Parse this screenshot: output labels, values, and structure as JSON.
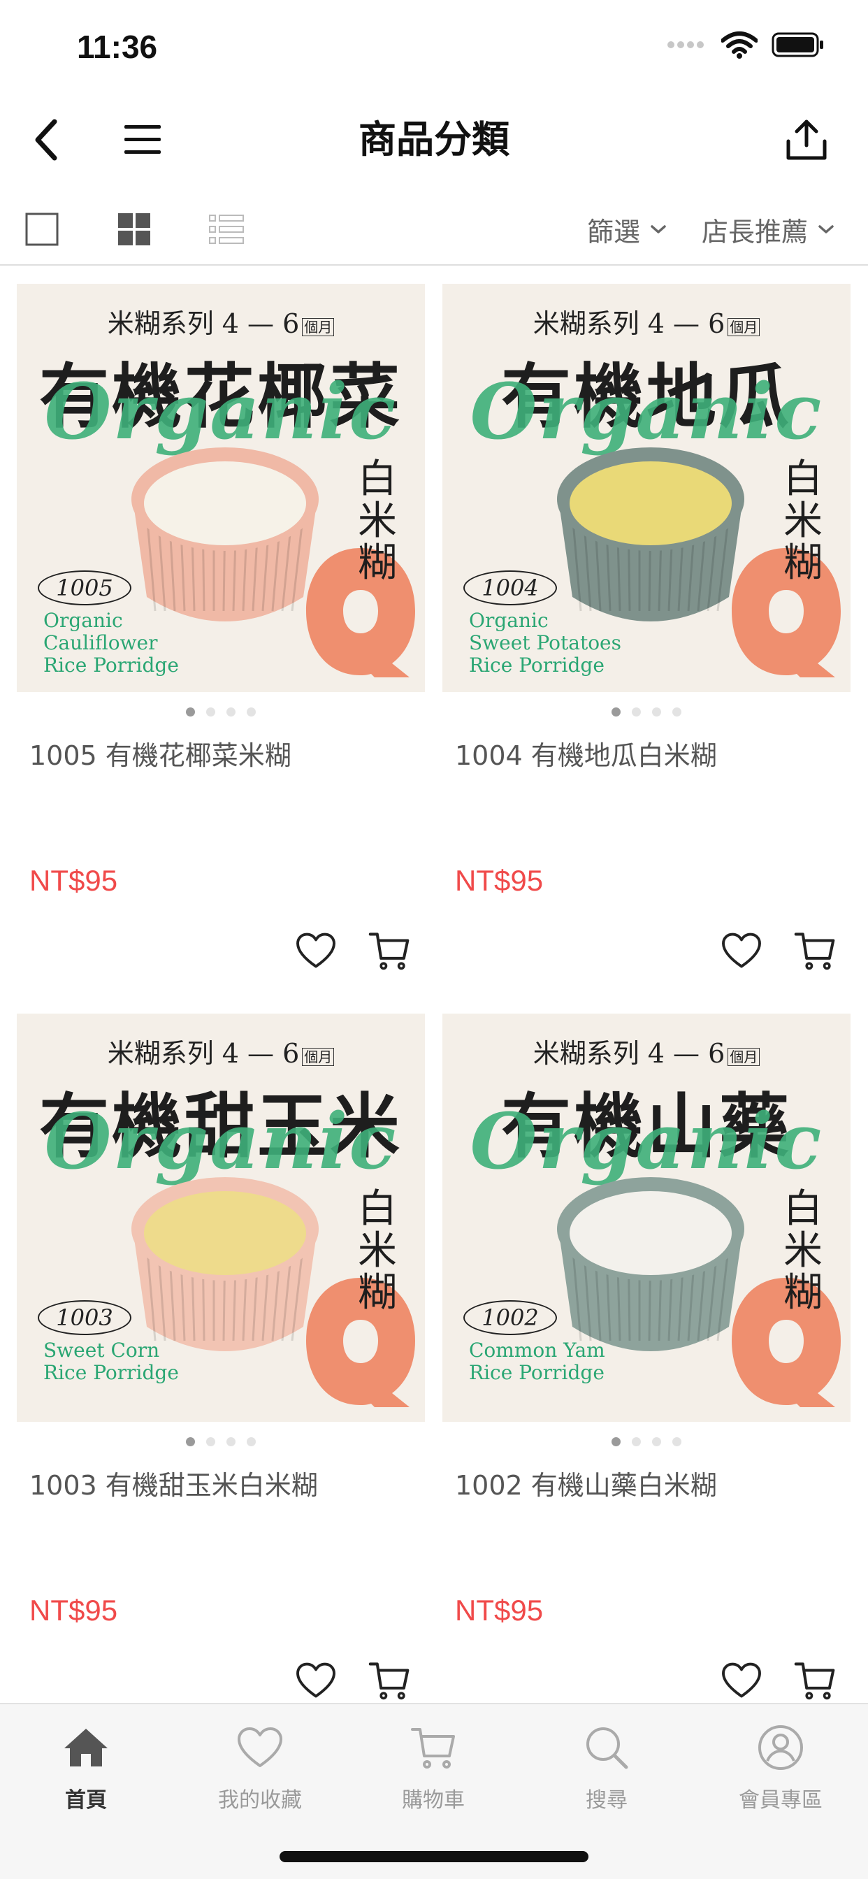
{
  "status_bar": {
    "time": "11:36"
  },
  "nav": {
    "title": "商品分類"
  },
  "toolbar": {
    "filter_label": "篩選",
    "sort_label": "店長推薦"
  },
  "products": [
    {
      "series": "米糊系列 4 — 6",
      "series_unit": "個月",
      "big_name": "有機花椰菜",
      "organic": "Organic",
      "white_rice": "白米糊",
      "code": "1005",
      "english_name": "Organic\nCauliflower\nRice Porridge",
      "title": "1005 有機花椰菜米糊",
      "price": "NT$95",
      "bowl_color": "#f0b9a6",
      "content_color": "#f6f2e8"
    },
    {
      "series": "米糊系列 4 — 6",
      "series_unit": "個月",
      "big_name": "有機地瓜",
      "organic": "Organic",
      "white_rice": "白米糊",
      "code": "1004",
      "english_name": "Organic\nSweet Potatoes\nRice Porridge",
      "title": "1004 有機地瓜白米糊",
      "price": "NT$95",
      "bowl_color": "#7f928c",
      "content_color": "#e9d977"
    },
    {
      "series": "米糊系列 4 — 6",
      "series_unit": "個月",
      "big_name": "有機甜玉米",
      "organic": "Organic",
      "white_rice": "白米糊",
      "code": "1003",
      "english_name": "Sweet Corn\nRice Porridge",
      "title": "1003 有機甜玉米白米糊",
      "price": "NT$95",
      "bowl_color": "#f2c4b3",
      "content_color": "#eedb8c"
    },
    {
      "series": "米糊系列 4 — 6",
      "series_unit": "個月",
      "big_name": "有機山藥",
      "organic": "Organic",
      "white_rice": "白米糊",
      "code": "1002",
      "english_name": "Common Yam\nRice Porridge",
      "title": "1002 有機山藥白米糊",
      "price": "NT$95",
      "bowl_color": "#8ea39c",
      "content_color": "#f3f1ec"
    }
  ],
  "tabs": [
    {
      "label": "首頁",
      "icon": "home-icon",
      "active": true
    },
    {
      "label": "我的收藏",
      "icon": "heart-icon",
      "active": false
    },
    {
      "label": "購物車",
      "icon": "cart-icon",
      "active": false
    },
    {
      "label": "搜尋",
      "icon": "search-icon",
      "active": false
    },
    {
      "label": "會員專區",
      "icon": "user-icon",
      "active": false
    }
  ],
  "colors": {
    "price": "#f04a4a",
    "accent_green": "#3fb07a",
    "q_orange": "#ef8f6f"
  }
}
